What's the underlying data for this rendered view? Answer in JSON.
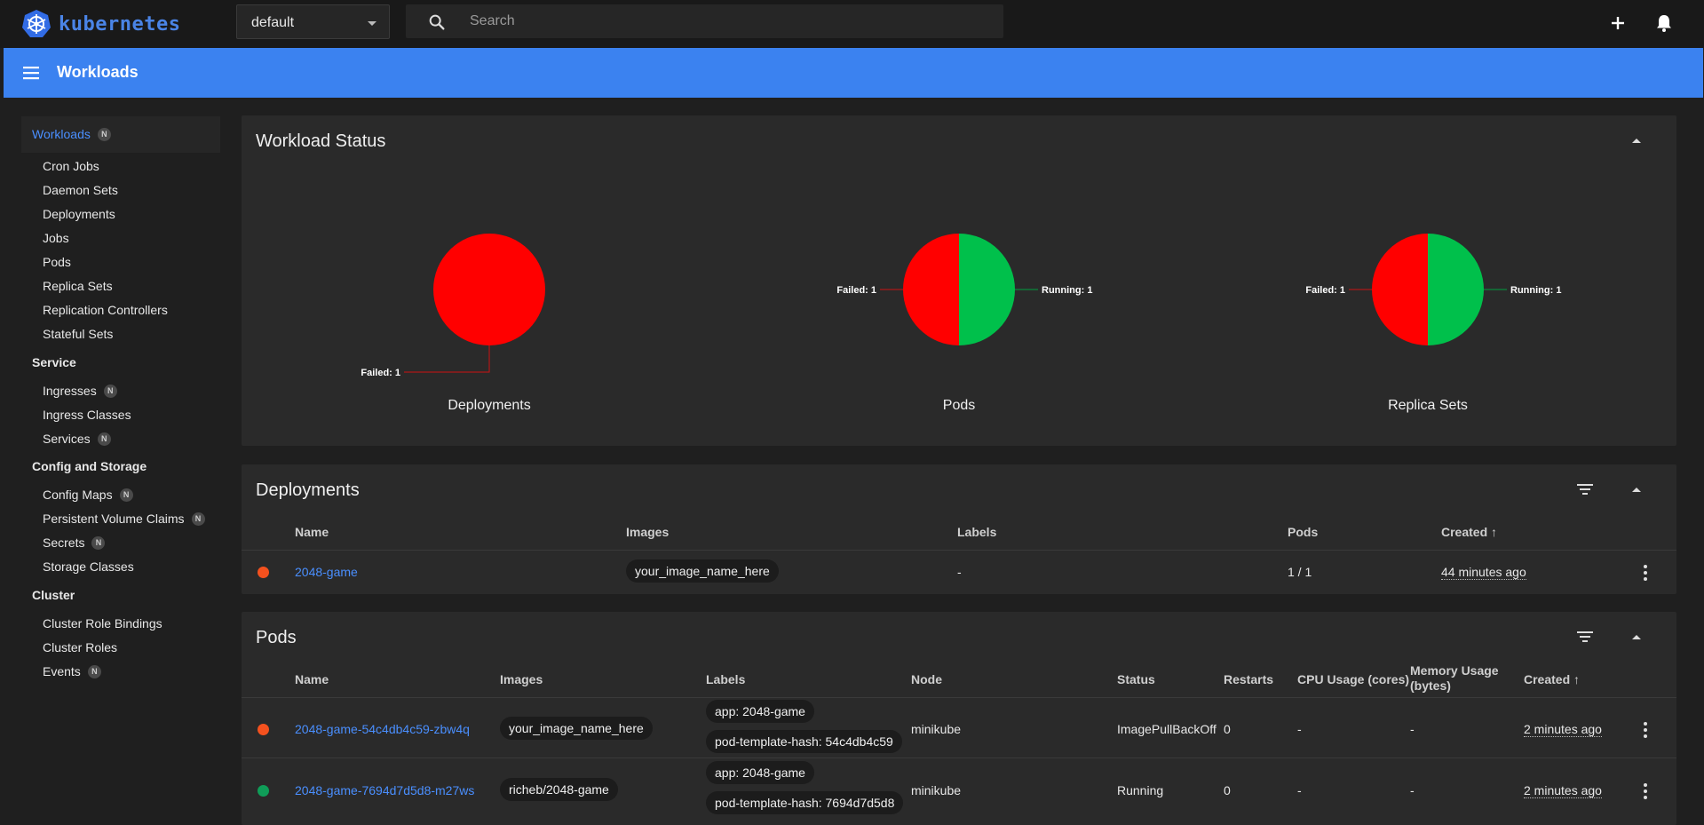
{
  "app": {
    "logo_text": "kubernetes"
  },
  "namespace": {
    "value": "default"
  },
  "search": {
    "placeholder": "Search"
  },
  "header": {
    "title": "Workloads"
  },
  "sidebar": {
    "workloads": {
      "label": "Workloads",
      "badge": "N"
    },
    "workload_items": [
      "Cron Jobs",
      "Daemon Sets",
      "Deployments",
      "Jobs",
      "Pods",
      "Replica Sets",
      "Replication Controllers",
      "Stateful Sets"
    ],
    "service_head": "Service",
    "service_items": [
      {
        "label": "Ingresses",
        "badge": "N"
      },
      {
        "label": "Ingress Classes",
        "badge": ""
      },
      {
        "label": "Services",
        "badge": "N"
      }
    ],
    "config_head": "Config and Storage",
    "config_items": [
      {
        "label": "Config Maps",
        "badge": "N"
      },
      {
        "label": "Persistent Volume Claims",
        "badge": "N"
      },
      {
        "label": "Secrets",
        "badge": "N"
      },
      {
        "label": "Storage Classes",
        "badge": ""
      }
    ],
    "cluster_head": "Cluster",
    "cluster_items": [
      {
        "label": "Cluster Role Bindings",
        "badge": ""
      },
      {
        "label": "Cluster Roles",
        "badge": ""
      },
      {
        "label": "Events",
        "badge": "N"
      }
    ]
  },
  "workload_status": {
    "title": "Workload Status",
    "charts": [
      {
        "name": "Deployments",
        "failed_label": "Failed: 1",
        "running_label": ""
      },
      {
        "name": "Pods",
        "failed_label": "Failed: 1",
        "running_label": "Running: 1"
      },
      {
        "name": "Replica Sets",
        "failed_label": "Failed: 1",
        "running_label": "Running: 1"
      }
    ]
  },
  "chart_data": [
    {
      "type": "pie",
      "title": "Deployments",
      "categories": [
        "Failed"
      ],
      "values": [
        1
      ]
    },
    {
      "type": "pie",
      "title": "Pods",
      "categories": [
        "Failed",
        "Running"
      ],
      "values": [
        1,
        1
      ]
    },
    {
      "type": "pie",
      "title": "Replica Sets",
      "categories": [
        "Failed",
        "Running"
      ],
      "values": [
        1,
        1
      ]
    }
  ],
  "colors": {
    "failed": "#ff0000",
    "running": "#00c04b",
    "accent": "#3b82f0",
    "error_dot": "#f4511e",
    "ok_dot": "#0f9d58"
  },
  "deployments": {
    "title": "Deployments",
    "headers": {
      "name": "Name",
      "images": "Images",
      "labels": "Labels",
      "pods": "Pods",
      "created": "Created ↑"
    },
    "rows": [
      {
        "name": "2048-game",
        "image": "your_image_name_here",
        "labels": "-",
        "pods": "1 / 1",
        "created": "44 minutes ago"
      }
    ]
  },
  "pods": {
    "title": "Pods",
    "headers": {
      "name": "Name",
      "images": "Images",
      "labels": "Labels",
      "node": "Node",
      "status": "Status",
      "restarts": "Restarts",
      "cpu": "CPU Usage (cores)",
      "memory": "Memory Usage (bytes)",
      "created": "Created ↑"
    },
    "rows": [
      {
        "name": "2048-game-54c4db4c59-zbw4q",
        "image": "your_image_name_here",
        "label1": "app: 2048-game",
        "label2": "pod-template-hash: 54c4db4c59",
        "node": "minikube",
        "status": "ImagePullBackOff",
        "restarts": "0",
        "cpu": "-",
        "memory": "-",
        "created": "2 minutes ago"
      },
      {
        "name": "2048-game-7694d7d5d8-m27ws",
        "image": "richeb/2048-game",
        "label1": "app: 2048-game",
        "label2": "pod-template-hash: 7694d7d5d8",
        "node": "minikube",
        "status": "Running",
        "restarts": "0",
        "cpu": "-",
        "memory": "-",
        "created": "2 minutes ago"
      }
    ]
  }
}
